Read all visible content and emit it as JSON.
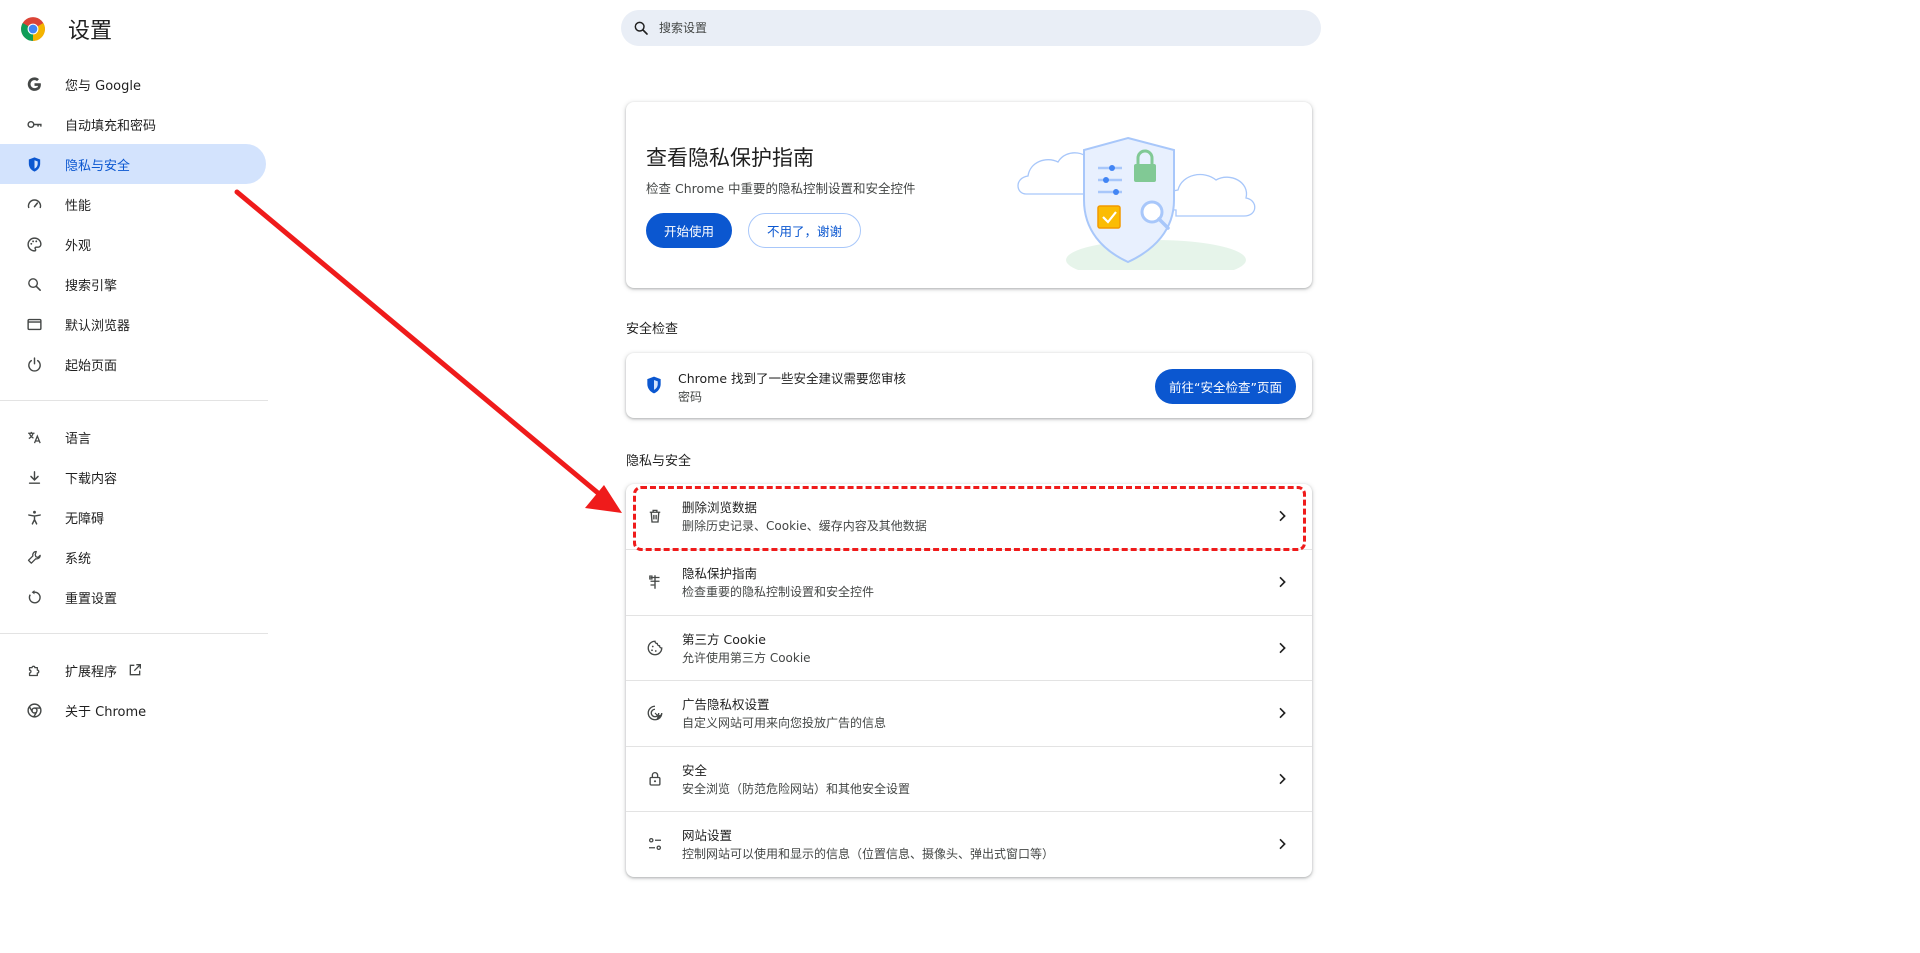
{
  "header": {
    "title": "设置",
    "search_placeholder": "搜索设置"
  },
  "sidebar": {
    "items": [
      {
        "label": "您与 Google",
        "icon": "google-g-icon"
      },
      {
        "label": "自动填充和密码",
        "icon": "key-icon"
      },
      {
        "label": "隐私与安全",
        "icon": "shield-icon",
        "active": true
      },
      {
        "label": "性能",
        "icon": "speedometer-icon"
      },
      {
        "label": "外观",
        "icon": "palette-icon"
      },
      {
        "label": "搜索引擎",
        "icon": "search-icon"
      },
      {
        "label": "默认浏览器",
        "icon": "browser-window-icon"
      },
      {
        "label": "起始页面",
        "icon": "power-icon"
      }
    ],
    "items2": [
      {
        "label": "语言",
        "icon": "translate-icon"
      },
      {
        "label": "下载内容",
        "icon": "download-icon"
      },
      {
        "label": "无障碍",
        "icon": "accessibility-icon"
      },
      {
        "label": "系统",
        "icon": "wrench-icon"
      },
      {
        "label": "重置设置",
        "icon": "reset-icon"
      }
    ],
    "items3": [
      {
        "label": "扩展程序",
        "icon": "puzzle-icon"
      },
      {
        "label": "关于 Chrome",
        "icon": "chrome-icon"
      }
    ]
  },
  "privacy_guide": {
    "title": "查看隐私保护指南",
    "description": "检查 Chrome 中重要的隐私控制设置和安全控件",
    "start_label": "开始使用",
    "dismiss_label": "不用了，谢谢"
  },
  "safety_check": {
    "section_title": "安全检查",
    "message": "Chrome 找到了一些安全建议需要您审核",
    "sub": "密码",
    "button_label": "前往“安全检查”页面"
  },
  "privacy_section": {
    "section_title": "隐私与安全",
    "rows": [
      {
        "title": "删除浏览数据",
        "desc": "删除历史记录、Cookie、缓存内容及其他数据",
        "icon": "trash-icon"
      },
      {
        "title": "隐私保护指南",
        "desc": "检查重要的隐私控制设置和安全控件",
        "icon": "privacy-guide-icon"
      },
      {
        "title": "第三方 Cookie",
        "desc": "允许使用第三方 Cookie",
        "icon": "cookie-icon"
      },
      {
        "title": "广告隐私权设置",
        "desc": "自定义网站可用来向您投放广告的信息",
        "icon": "ad-privacy-icon"
      },
      {
        "title": "安全",
        "desc": "安全浏览（防范危险网站）和其他安全设置",
        "icon": "lock-icon"
      },
      {
        "title": "网站设置",
        "desc": "控制网站可以使用和显示的信息（位置信息、摄像头、弹出式窗口等）",
        "icon": "site-settings-icon"
      }
    ]
  },
  "colors": {
    "accent": "#0b57d0",
    "active_nav_bg": "#d3e3fd",
    "annotation": "#ef1b1b"
  }
}
